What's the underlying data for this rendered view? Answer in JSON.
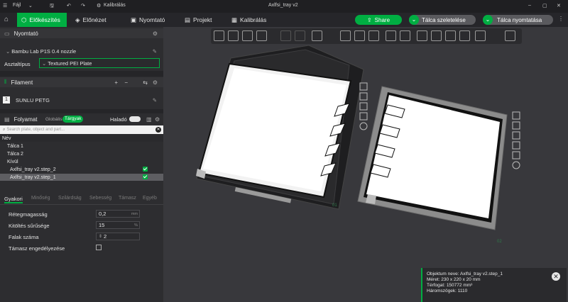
{
  "titlebar": {
    "menu_label": "Fájl",
    "calib_label": "Kalibrálás",
    "doc_title": "Axlfsi_tray v2"
  },
  "tabs": [
    {
      "label": "Előkészítés"
    },
    {
      "label": "Előnézet"
    },
    {
      "label": "Nyomtató"
    },
    {
      "label": "Projekt"
    },
    {
      "label": "Kalibrálás"
    }
  ],
  "actions": {
    "share": "Share",
    "slice": "Tálca szeletelése",
    "print": "Tálca nyomtatása"
  },
  "printer": {
    "section": "Nyomtató",
    "model": "Bambu Lab P1S 0.4 nozzle",
    "plate_label": "Asztaltípus",
    "plate_value": "Textured PEI Plate"
  },
  "filament": {
    "section": "Filament",
    "slot": "1",
    "name": "SUNLU PETG"
  },
  "process": {
    "section": "Folyamat",
    "global": "Globális",
    "objects": "Tárgyak",
    "advanced": "Haladó"
  },
  "search": {
    "placeholder": "Search plate, object and part..."
  },
  "tree": {
    "name_header": "Név",
    "items": [
      "Tálca 1",
      "Tálca 2",
      "Kívül",
      "Axlfsi_tray v2.step_2",
      "Axlfsi_tray v2.step_1"
    ]
  },
  "settings_tabs": [
    "Gyakori",
    "Minőség",
    "Szilárdság",
    "Sebesség",
    "Támasz",
    "Egyéb"
  ],
  "params": [
    {
      "label": "Rétegmagasság",
      "value": "0,2",
      "unit": "mm"
    },
    {
      "label": "Kitöltés sűrűsége",
      "value": "15",
      "unit": "%"
    },
    {
      "label": "Falak száma",
      "value": "2",
      "unit": ""
    },
    {
      "label": "Támasz engedélyezése",
      "value": "",
      "unit": ""
    }
  ],
  "plates": {
    "p1": "01",
    "p2": "02"
  },
  "info": {
    "name": "Objektum neve: Axlfsi_tray v2.step_1",
    "size": "Méret: 230 x 220 x 20 mm",
    "volume": "Térfogat: 150772 mm³",
    "tris": "Háromszögek: 1110"
  },
  "colors": {
    "accent": "#00ae42",
    "panel": "#2d2d30",
    "viewport": "#38383c"
  }
}
